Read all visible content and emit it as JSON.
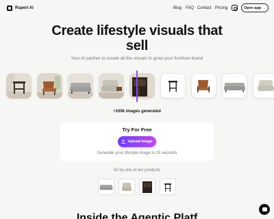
{
  "nav": {
    "brand": "Rupert AI",
    "links": [
      "Blog",
      "FAQ",
      "Contact",
      "Pricing"
    ],
    "instagram_icon": "instagram-icon",
    "open_app": "Open app",
    "open_app_icon": "arrow-right-icon"
  },
  "hero": {
    "title_line1": "Create lifestyle visuals that",
    "title_line2": "sell",
    "subtitle": "Your AI partner to create all the visuals to grow your furniture brand"
  },
  "carousel": {
    "lifestyle_images": [
      "side-table-lifestyle",
      "armchair-lifestyle",
      "sofa-lifestyle",
      "armchair-lifestyle-2",
      "cabinet-lifestyle"
    ],
    "product_images": [
      "cabinet-product",
      "side-table-product",
      "armchair-product",
      "sofa-product",
      "chair-product"
    ],
    "accent_color": "#8a4bf0"
  },
  "stats": {
    "images_generated": "+100k images generated"
  },
  "try_card": {
    "title": "Try For Free",
    "upload_label": "Upload image",
    "upload_icon": "upload-icon",
    "note": "Generate your lifestyle image in 15 seconds",
    "button_gradient": [
      "#6d3ef5",
      "#c04ae8"
    ]
  },
  "products": {
    "label": "Or try one of our products",
    "items": [
      "sofa",
      "armchair",
      "cabinet",
      "side-table"
    ]
  },
  "next_section": {
    "title": "Inside the Agentic Platf"
  },
  "chat_icon": "chat-icon"
}
